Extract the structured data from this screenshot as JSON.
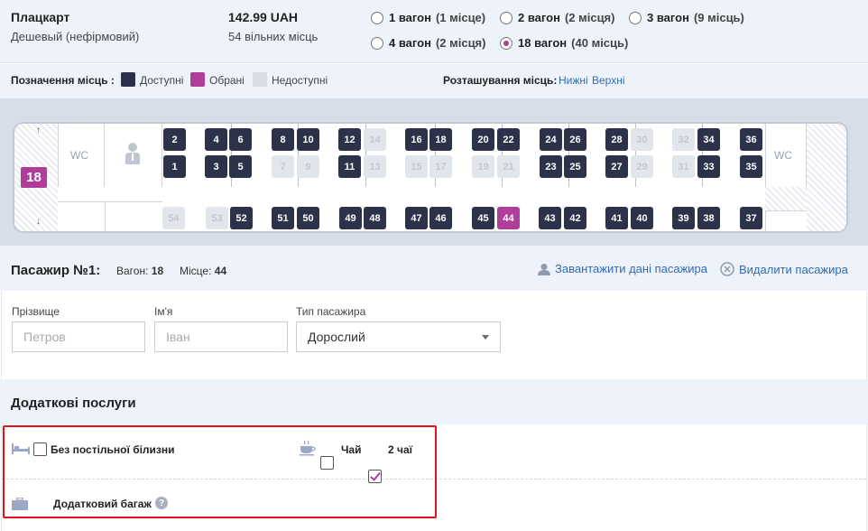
{
  "train": {
    "car_class": "Плацкарт",
    "car_subtitle": "Дешевый (нефірмовий)",
    "price": "142.99 UAH",
    "free_seats": "54 вільних місць"
  },
  "wagons": [
    {
      "label": "1 вагон",
      "seats": "(1 місце)",
      "selected": false
    },
    {
      "label": "2 вагон",
      "seats": "(2 місця)",
      "selected": false
    },
    {
      "label": "3 вагон",
      "seats": "(9 місць)",
      "selected": false
    },
    {
      "label": "4 вагон",
      "seats": "(2 місця)",
      "selected": false
    },
    {
      "label": "18 вагон",
      "seats": "(40 місць)",
      "selected": true
    }
  ],
  "legend": {
    "title": "Позначення місць :",
    "available": "Доступні",
    "selected": "Обрані",
    "unavailable": "Недоступні",
    "available_color": "#2b3249",
    "selected_color": "#b03d9a",
    "unavailable_color": "#d6dbe4",
    "location_title": "Розташування місць:",
    "lower_link": "Нижні",
    "upper_link": "Верхні"
  },
  "scheme": {
    "car_number": "18",
    "wc_left": "WC",
    "wc_right": "WC",
    "seats": [
      {
        "n": "2",
        "s": "a"
      },
      {
        "n": "1",
        "s": "a"
      },
      {
        "n": "4",
        "s": "a"
      },
      {
        "n": "3",
        "s": "a"
      },
      {
        "n": "6",
        "s": "a"
      },
      {
        "n": "5",
        "s": "a"
      },
      {
        "n": "8",
        "s": "a"
      },
      {
        "n": "7",
        "s": "u"
      },
      {
        "n": "10",
        "s": "a"
      },
      {
        "n": "9",
        "s": "u"
      },
      {
        "n": "12",
        "s": "a"
      },
      {
        "n": "11",
        "s": "a"
      },
      {
        "n": "14",
        "s": "u"
      },
      {
        "n": "13",
        "s": "u"
      },
      {
        "n": "16",
        "s": "a"
      },
      {
        "n": "15",
        "s": "u"
      },
      {
        "n": "18",
        "s": "a"
      },
      {
        "n": "17",
        "s": "u"
      },
      {
        "n": "20",
        "s": "a"
      },
      {
        "n": "19",
        "s": "u"
      },
      {
        "n": "22",
        "s": "a"
      },
      {
        "n": "21",
        "s": "u"
      },
      {
        "n": "24",
        "s": "a"
      },
      {
        "n": "23",
        "s": "a"
      },
      {
        "n": "26",
        "s": "a"
      },
      {
        "n": "25",
        "s": "a"
      },
      {
        "n": "28",
        "s": "a"
      },
      {
        "n": "27",
        "s": "a"
      },
      {
        "n": "30",
        "s": "u"
      },
      {
        "n": "29",
        "s": "u"
      },
      {
        "n": "32",
        "s": "u"
      },
      {
        "n": "31",
        "s": "u"
      },
      {
        "n": "34",
        "s": "a"
      },
      {
        "n": "33",
        "s": "a"
      },
      {
        "n": "36",
        "s": "a"
      },
      {
        "n": "35",
        "s": "a"
      },
      {
        "n": "54",
        "s": "u"
      },
      {
        "n": "53",
        "s": "u"
      },
      {
        "n": "52",
        "s": "a"
      },
      {
        "n": "51",
        "s": "a"
      },
      {
        "n": "50",
        "s": "a"
      },
      {
        "n": "49",
        "s": "a"
      },
      {
        "n": "48",
        "s": "a"
      },
      {
        "n": "47",
        "s": "a"
      },
      {
        "n": "46",
        "s": "a"
      },
      {
        "n": "45",
        "s": "a"
      },
      {
        "n": "44",
        "s": "s"
      },
      {
        "n": "43",
        "s": "a"
      },
      {
        "n": "42",
        "s": "a"
      },
      {
        "n": "41",
        "s": "a"
      },
      {
        "n": "40",
        "s": "a"
      },
      {
        "n": "39",
        "s": "a"
      },
      {
        "n": "38",
        "s": "a"
      },
      {
        "n": "37",
        "s": "a"
      }
    ]
  },
  "passenger": {
    "title": "Пасажир №1:",
    "wagon_label": "Вагон:",
    "wagon_value": "18",
    "seat_label": "Місце:",
    "seat_value": "44",
    "load_link": "Завантажити дані пасажира",
    "delete_link": "Видалити пасажира",
    "surname_label": "Прізвище",
    "surname_placeholder": "Петров",
    "name_label": "Ім'я",
    "name_placeholder": "Іван",
    "type_label": "Тип пасажира",
    "type_value": "Дорослий"
  },
  "services": {
    "title": "Додаткові послуги",
    "no_linen": "Без постільної білизни",
    "no_linen_checked": false,
    "tea": "Чай",
    "tea_checked": false,
    "two_tea": "2 чаї",
    "two_tea_checked": true,
    "extra_baggage": "Додатковий багаж",
    "extra_baggage_checked": false,
    "help": "?"
  }
}
